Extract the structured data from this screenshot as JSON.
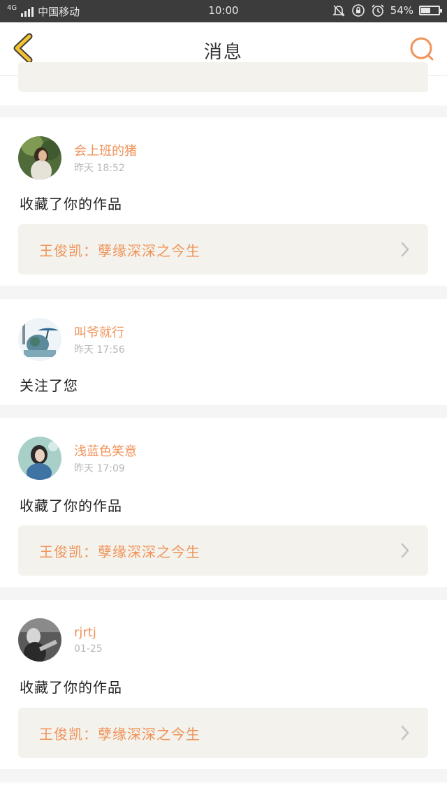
{
  "status_bar": {
    "network": "4G",
    "carrier": "中国移动",
    "time": "10:00",
    "battery_percent": "54%",
    "battery_level": 0.54,
    "icons": [
      "signal-icon",
      "mute-bell-icon",
      "rotation-lock-icon",
      "alarm-icon",
      "battery-icon"
    ]
  },
  "header": {
    "title": "消息",
    "back_icon": "chevron-left-icon",
    "search_icon": "search-icon",
    "accent_back": "#f2c230",
    "accent_search": "#f0935a"
  },
  "messages": [
    {
      "user": "会上班的猪",
      "time": "昨天 18:52",
      "action": "收藏了你的作品",
      "work": "王俊凯：孽缘深深之今生"
    },
    {
      "user": "叫爷就行",
      "time": "昨天 17:56",
      "action": "关注了您"
    },
    {
      "user": "浅蓝色笑意",
      "time": "昨天 17:09",
      "action": "收藏了你的作品",
      "work": "王俊凯：孽缘深深之今生"
    },
    {
      "user": "rjrtj",
      "time": "01-25",
      "action": "收藏了你的作品",
      "work": "王俊凯：孽缘深深之今生"
    }
  ],
  "colors": {
    "username": "#f0935a",
    "work_title": "#f0935a",
    "work_box_bg": "#f3f2ec",
    "page_bg": "#f5f5f5"
  }
}
